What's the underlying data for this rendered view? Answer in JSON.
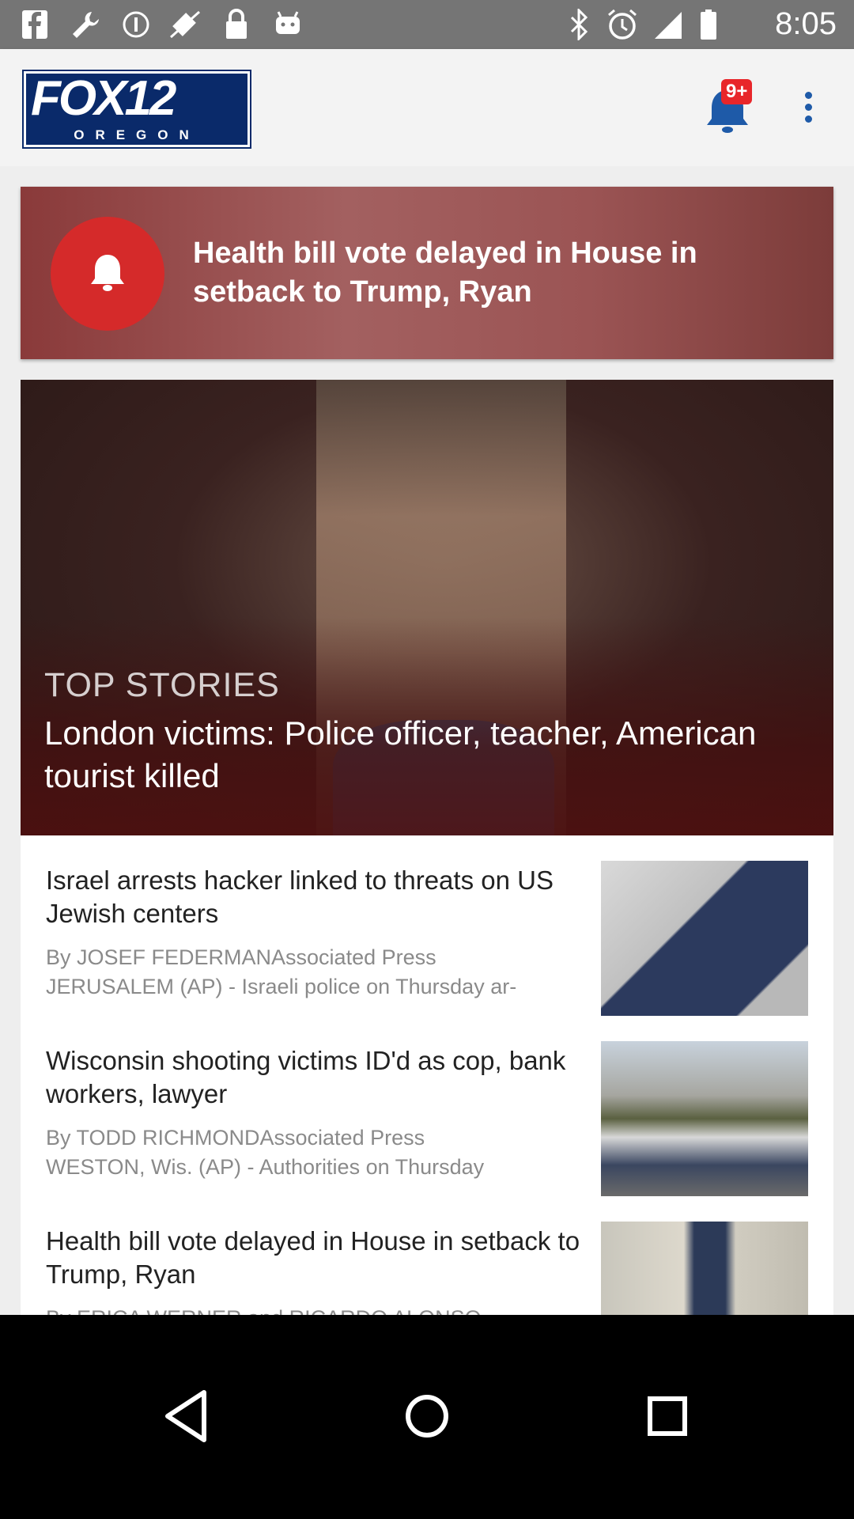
{
  "status_bar": {
    "time": "8:05",
    "left_icons": [
      "facebook-icon",
      "wrench-icon",
      "info-icon",
      "no-gps-icon",
      "lock-icon",
      "android-icon"
    ],
    "right_icons": [
      "bluetooth-icon",
      "alarm-icon",
      "signal-icon",
      "battery-icon"
    ]
  },
  "app_bar": {
    "logo_text": "FOX12",
    "logo_subtext": "OREGON",
    "notification_badge": "9+"
  },
  "alert": {
    "title": "Health bill vote delayed in House in setback to Trump, Ryan"
  },
  "top_story": {
    "label": "TOP STORIES",
    "title": "London victims: Police officer, teacher, American tourist killed"
  },
  "articles": [
    {
      "title": "Israel arrests hacker linked to threats on US Jewish centers",
      "line1": "By JOSEF FEDERMANAssociated Press",
      "line2": "JERUSALEM (AP) - Israeli police on Thursday ar-"
    },
    {
      "title": "Wisconsin shooting victims ID'd as cop, bank workers, lawyer",
      "line1": "By TODD RICHMONDAssociated Press",
      "line2": "WESTON, Wis. (AP) - Authorities on Thursday"
    },
    {
      "title": "Health bill vote delayed in House in setback to Trump, Ryan",
      "line1": "By ERICA WERNER and RICARDO ALONSO-",
      "line2": ""
    }
  ],
  "colors": {
    "status_bar": "#757575",
    "app_bar": "#f3f3f3",
    "accent_blue": "#1e5aa8",
    "alert_red": "#d52a2a"
  }
}
